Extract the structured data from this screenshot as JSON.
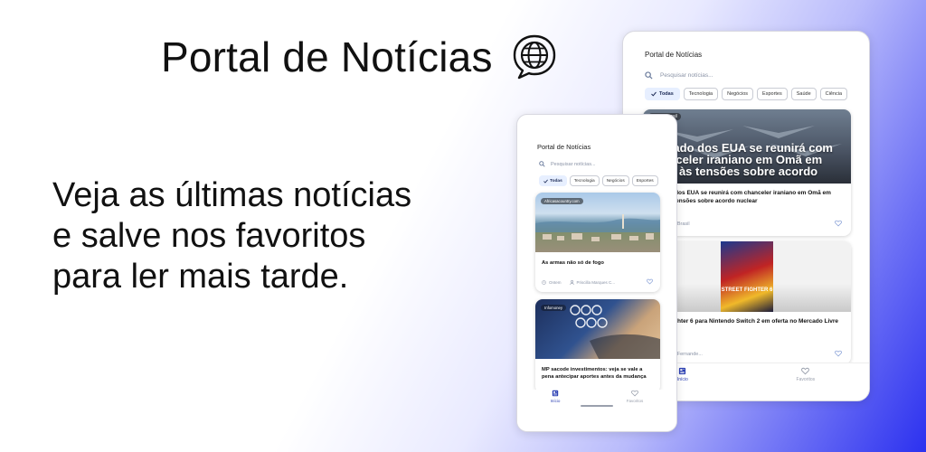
{
  "promo": {
    "headline": "Portal de Notícias",
    "tagline_lines": [
      "Veja as últimas notícias",
      "e salve nos favoritos",
      "para ler mais tarde."
    ]
  },
  "colors": {
    "primary": "#2f43b5",
    "chip_selected_bg": "#e7efff",
    "gradient_end": "#2c31ef"
  },
  "tablet": {
    "app_title": "Portal de Notícias",
    "search_placeholder": "Pesquisar notícias...",
    "chips": [
      "Todas",
      "Tecnologia",
      "Negócios",
      "Esportes",
      "Saúde",
      "Ciência"
    ],
    "cards": [
      {
        "source_badge": "sputnikbrasil",
        "image_overlay_text": "Enviado dos EUA se reunirá com chanceler iraniano em Omã em meio às tensões sobre acordo",
        "title": "Enviado dos EUA se reunirá com chanceler iraniano em Omã em meio às tensões sobre acordo nuclear",
        "author": "Sputnik Brasil"
      },
      {
        "image_text": "STREET FIGHTER 6",
        "title": "Street Fighter 6 para Nintendo Switch 2 em oferta no Mercado Livre",
        "author": "Victoria Fernande..."
      }
    ],
    "nav": [
      "Início",
      "Favoritos"
    ]
  },
  "phone": {
    "app_title": "Portal de Notícias",
    "search_placeholder": "Pesquisar notícias...",
    "chips": [
      "Todas",
      "Tecnologia",
      "Negócios",
      "Esportes"
    ],
    "cards": [
      {
        "source_badge": "Africasacountry.com",
        "title": "As armas não só de fogo",
        "date": "Ontem",
        "author": "Priscilla Marques C..."
      },
      {
        "source_badge": "Infomoney",
        "title": "MP sacode investimentos: veja se vale a pena antecipar aportes antes da mudança"
      }
    ],
    "nav": [
      "Início",
      "Favoritos"
    ]
  }
}
